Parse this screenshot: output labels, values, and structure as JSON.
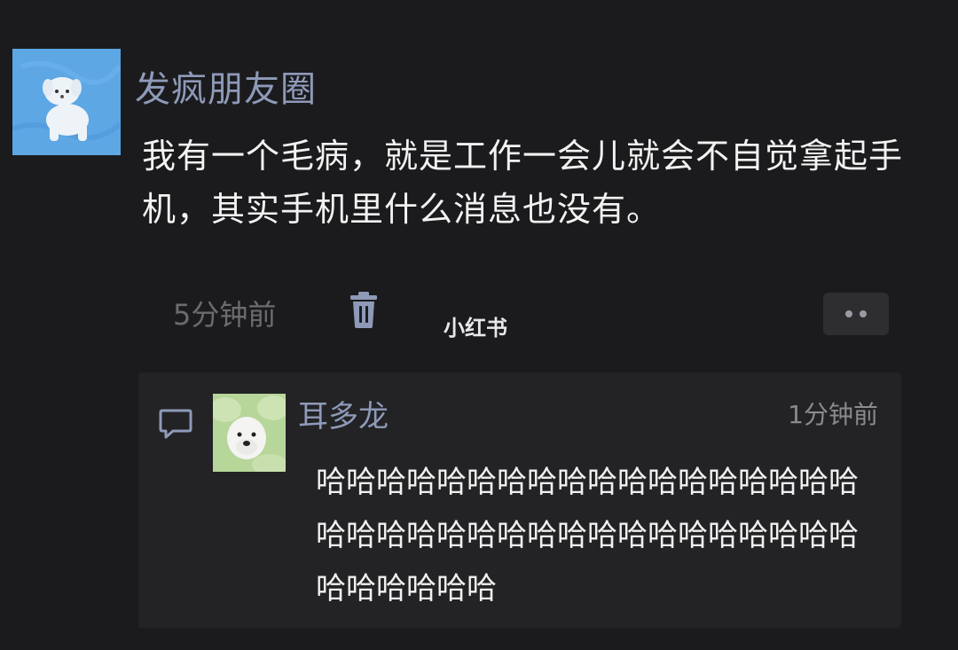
{
  "post": {
    "author": "发疯朋友圈",
    "body": "我有一个毛病，就是工作一会儿就会不自觉拿起手机，其实手机里什么消息也没有。",
    "time": "5分钟前"
  },
  "watermark": "小红书",
  "comment": {
    "author": "耳多龙",
    "time": "1分钟前",
    "text": "哈哈哈哈哈哈哈哈哈哈哈哈哈哈哈哈哈哈哈哈哈哈哈哈哈哈哈哈哈哈哈哈哈哈哈哈哈哈哈哈哈哈"
  },
  "icons": {
    "delete": "trash-icon",
    "more": "more-dots-icon",
    "comment": "comment-bubble-icon"
  },
  "colors": {
    "background": "#1b1b1d",
    "author_name": "#8e9ab8",
    "avatar_bg": "#5fa8e6",
    "panel_bg": "#232325"
  }
}
